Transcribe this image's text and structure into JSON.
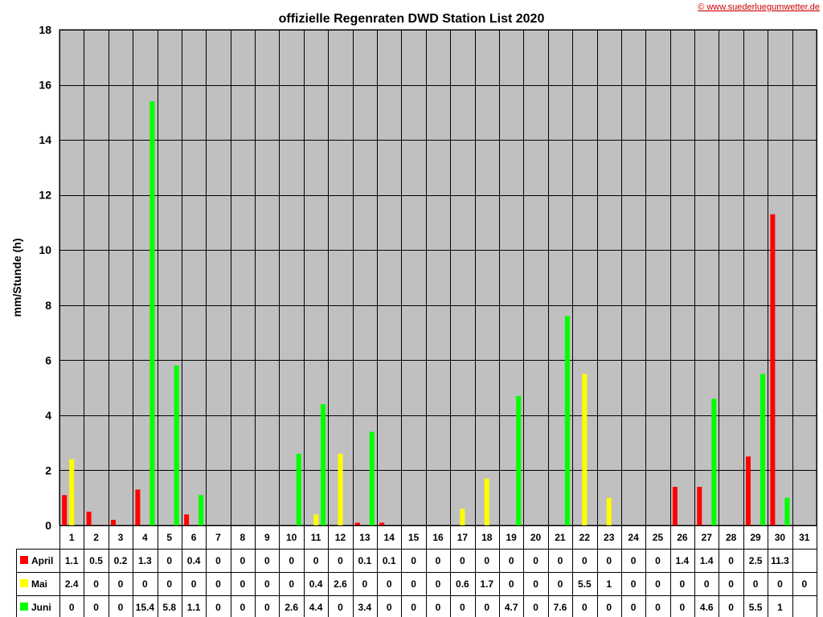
{
  "credit": "© www.suederluegumwetter.de",
  "chart_data": {
    "type": "bar",
    "title": "offizielle Regenraten DWD Station List 2020",
    "xlabel": "",
    "ylabel": "mm/Stunde (h)",
    "ylim": [
      0,
      18
    ],
    "yticks": [
      "0",
      "2",
      "4",
      "6",
      "8",
      "10",
      "12",
      "14",
      "16",
      "18"
    ],
    "grid": true,
    "legend": "table-below",
    "categories": [
      "1",
      "2",
      "3",
      "4",
      "5",
      "6",
      "7",
      "8",
      "9",
      "10",
      "11",
      "12",
      "13",
      "14",
      "15",
      "16",
      "17",
      "18",
      "19",
      "20",
      "21",
      "22",
      "23",
      "24",
      "25",
      "26",
      "27",
      "28",
      "29",
      "30",
      "31"
    ],
    "series": [
      {
        "name": "April",
        "color": "#ff0000",
        "values": [
          1.1,
          0.5,
          0.2,
          1.3,
          0,
          0.4,
          0,
          0,
          0,
          0,
          0,
          0,
          0.1,
          0.1,
          0,
          0,
          0,
          0,
          0,
          0,
          0,
          0,
          0,
          0,
          0,
          1.4,
          1.4,
          0,
          2.5,
          11.3,
          null
        ],
        "labels": [
          "1.1",
          "0.5",
          "0.2",
          "1.3",
          "0",
          "0.4",
          "0",
          "0",
          "0",
          "0",
          "0",
          "0",
          "0.1",
          "0.1",
          "0",
          "0",
          "0",
          "0",
          "0",
          "0",
          "0",
          "0",
          "0",
          "0",
          "0",
          "1.4",
          "1.4",
          "0",
          "2.5",
          "11.3",
          ""
        ]
      },
      {
        "name": "Mai",
        "color": "#ffff00",
        "values": [
          2.4,
          0,
          0,
          0,
          0,
          0,
          0,
          0,
          0,
          0,
          0.4,
          2.6,
          0,
          0,
          0,
          0,
          0.6,
          1.7,
          0,
          0,
          0,
          5.5,
          1,
          0,
          0,
          0,
          0,
          0,
          0,
          0,
          0
        ],
        "labels": [
          "2.4",
          "0",
          "0",
          "0",
          "0",
          "0",
          "0",
          "0",
          "0",
          "0",
          "0.4",
          "2.6",
          "0",
          "0",
          "0",
          "0",
          "0.6",
          "1.7",
          "0",
          "0",
          "0",
          "5.5",
          "1",
          "0",
          "0",
          "0",
          "0",
          "0",
          "0",
          "0",
          "0"
        ]
      },
      {
        "name": "Juni",
        "color": "#00ff00",
        "values": [
          0,
          0,
          0,
          15.4,
          5.8,
          1.1,
          0,
          0,
          0,
          2.6,
          4.4,
          0,
          3.4,
          0,
          0,
          0,
          0,
          0,
          4.7,
          0,
          7.6,
          0,
          0,
          0,
          0,
          0,
          4.6,
          0,
          5.5,
          1,
          null
        ],
        "labels": [
          "0",
          "0",
          "0",
          "15.4",
          "5.8",
          "1.1",
          "0",
          "0",
          "0",
          "2.6",
          "4.4",
          "0",
          "3.4",
          "0",
          "0",
          "0",
          "0",
          "0",
          "4.7",
          "0",
          "7.6",
          "0",
          "0",
          "0",
          "0",
          "0",
          "4.6",
          "0",
          "5.5",
          "1",
          ""
        ]
      }
    ]
  }
}
